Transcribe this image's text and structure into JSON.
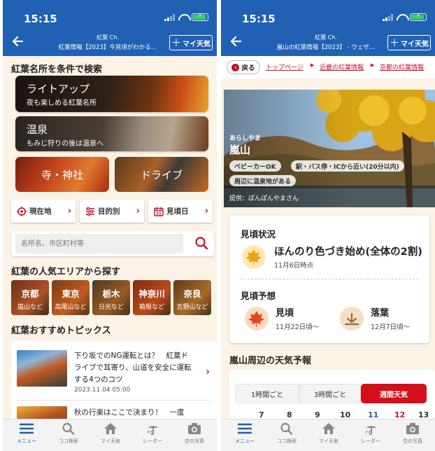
{
  "colors": {
    "header_blue": "#2161b3",
    "accent_red": "#c8102e",
    "page_bg": "#fbf3e6"
  },
  "left": {
    "status_time": "15:15",
    "header": {
      "channel": "紅葉 Ch.",
      "title": "紅葉情報【2023】今見頃がわかる…",
      "fav_button": "マイ天気"
    },
    "search_section_title": "紅葉名所を条件で検索",
    "banners": [
      {
        "title": "ライトアップ",
        "subtitle": "夜も楽しめる紅葉名所"
      },
      {
        "title": "温泉",
        "subtitle": "もみじ狩りの後は温泉へ"
      }
    ],
    "tiles": [
      "寺・神社",
      "ドライブ"
    ],
    "conditions": [
      {
        "label": "現在地",
        "icon": "location-icon"
      },
      {
        "label": "目的別",
        "icon": "filter-icon"
      },
      {
        "label": "見頃日",
        "icon": "calendar-icon"
      }
    ],
    "search_placeholder": "名所名、市区町村等",
    "area_section_title": "紅葉の人気エリアから探す",
    "areas": [
      {
        "pref": "京都",
        "sub": "嵐山など"
      },
      {
        "pref": "東京",
        "sub": "高尾山など"
      },
      {
        "pref": "栃木",
        "sub": "日光など"
      },
      {
        "pref": "神奈川",
        "sub": "箱根など"
      },
      {
        "pref": "奈良",
        "sub": "吉野山など"
      }
    ],
    "topics_section_title": "紅葉おすすめトピックス",
    "topics": [
      {
        "title": "下り坂でのNG運転とは？　紅葉ドライブで耳寄り、山道を安全に運転する4つのコツ",
        "date": "2023.11.04 05:00"
      },
      {
        "title": "秋の行楽はここで決まり！　一度",
        "date": ""
      }
    ]
  },
  "right": {
    "status_time": "15:15",
    "header": {
      "channel": "紅葉 Ch.",
      "title": "嵐山の紅葉情報【2023】 - ウェザ…",
      "fav_button": "マイ天気"
    },
    "back_label": "戻る",
    "breadcrumbs": [
      "トップページ",
      "近畿の紅葉情報",
      "京都の紅葉情報"
    ],
    "hero": {
      "reading": "あらしやま",
      "name": "嵐山",
      "tags": [
        "ベビーカーOK",
        "駅・バス停・ICから近い(20分以内)",
        "周辺に温泉地がある"
      ],
      "credit": "提供：ぽんぽんやまさん"
    },
    "status": {
      "heading": "見頃状況",
      "text": "ほんのり色づき始め(全体の2割)",
      "as_of": "11月6日時点"
    },
    "forecast": {
      "heading": "見頃予想",
      "peak_label": "見頃",
      "peak_date": "11月22日頃〜",
      "fall_label": "落葉",
      "fall_date": "12月7日頃〜"
    },
    "weather_title": "嵐山周辺の天気予報",
    "weather_tabs": [
      "1時間ごと",
      "3時間ごと",
      "週間天気"
    ],
    "date_strip": [
      "7",
      "8",
      "9",
      "10",
      "11",
      "12",
      "13"
    ]
  },
  "nav": [
    {
      "label": "メニュー",
      "icon": "menu-icon"
    },
    {
      "label": "ココ検索",
      "icon": "search-icon"
    },
    {
      "label": "マイ天気",
      "icon": "home-icon"
    },
    {
      "label": "レーダー",
      "icon": "radar-icon"
    },
    {
      "label": "空の写真",
      "icon": "camera-icon"
    }
  ]
}
